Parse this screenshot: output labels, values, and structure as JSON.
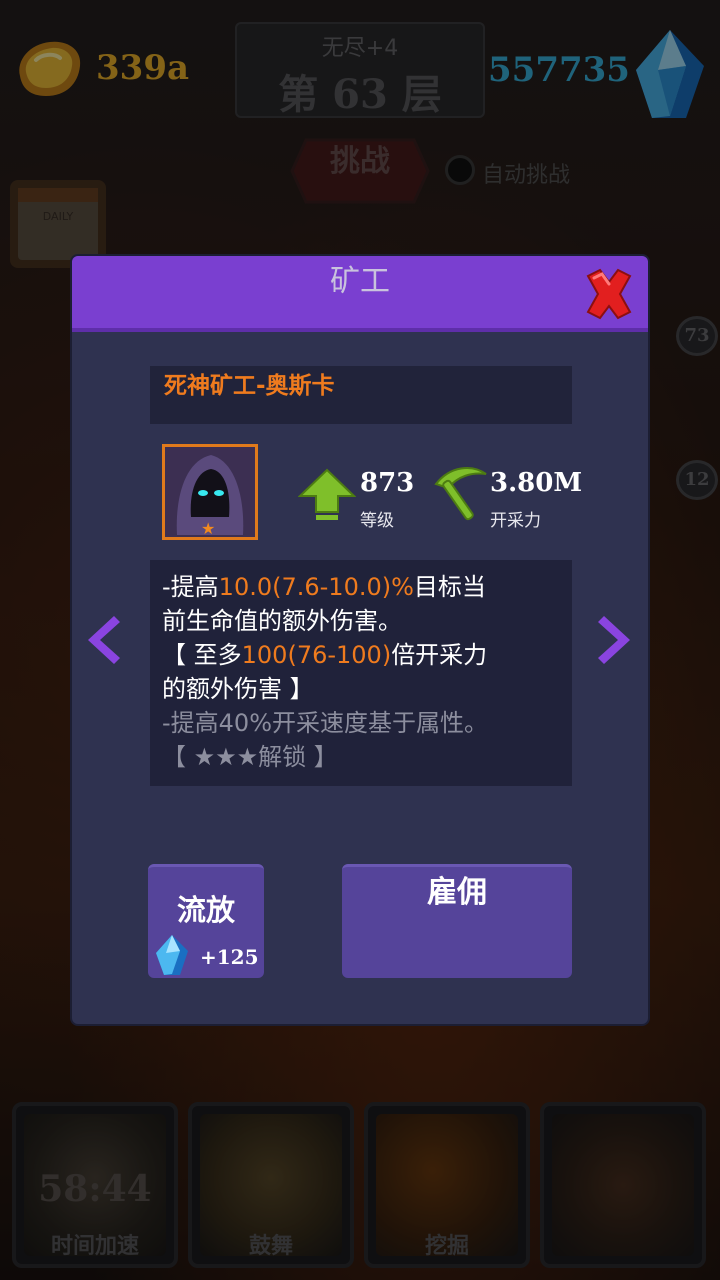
{
  "top_bar": {
    "gold_amount": "339a",
    "floor_subtitle": "无尽+4",
    "floor_title": "第 63 层",
    "gem_amount": "557735"
  },
  "challenge": {
    "button_label": "挑战",
    "auto_label": "自动挑战",
    "auto_checked": false
  },
  "calendar_label": "DAILY",
  "side_badges": [
    "73",
    "12"
  ],
  "modal": {
    "title": "矿工",
    "miner_name": "死神矿工-奥斯卡",
    "stars": "★",
    "level_value": "873",
    "level_caption": "等级",
    "mining_value": "3.80M",
    "mining_caption": "开采力",
    "description": {
      "l1_a": "-提高",
      "l1_hl": "10.0(7.6-10.0)%",
      "l1_b": "目标当",
      "l2": "前生命值的额外伤害。",
      "l3_a": "【 至多",
      "l3_hl": "100(76-100)",
      "l3_b": "倍开采力",
      "l4": "的额外伤害 】",
      "l5": "-提高40%开采速度基于属性。",
      "l6": "【 ★★★解锁 】"
    },
    "exile_label": "流放",
    "exile_cost": "+125",
    "hire_label": "雇佣"
  },
  "skills": [
    {
      "label": "时间加速",
      "timer": "58:44"
    },
    {
      "label": "鼓舞"
    },
    {
      "label": "挖掘"
    },
    {
      "label": ""
    }
  ],
  "colors": {
    "header_purple": "#7a3fd0",
    "panel": "#2f3250",
    "highlight_orange": "#ef7b1e",
    "button_purple": "#55449a",
    "gold_text": "#f0b52a",
    "gem_text": "#39b4e0"
  }
}
